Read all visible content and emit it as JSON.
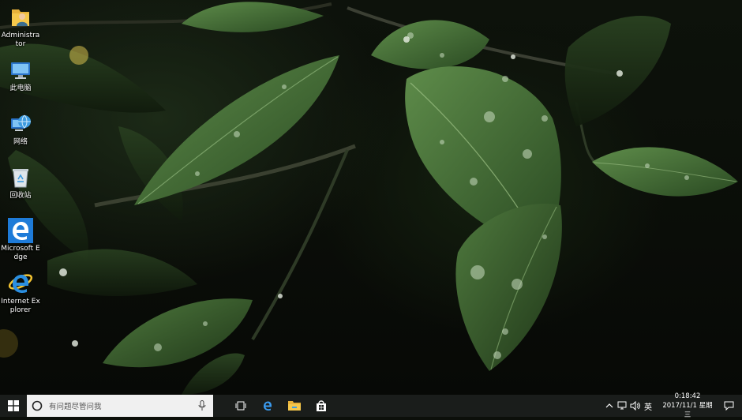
{
  "desktop": {
    "icons": [
      {
        "name": "user-folder",
        "label": "Administrator"
      },
      {
        "name": "this-pc",
        "label": "此电脑"
      },
      {
        "name": "network",
        "label": "网络"
      },
      {
        "name": "recycle-bin",
        "label": "回收站"
      },
      {
        "name": "microsoft-edge",
        "label": "Microsoft Edge"
      },
      {
        "name": "internet-explorer",
        "label": "Internet Explorer"
      }
    ]
  },
  "taskbar": {
    "search_placeholder": "有问题尽管问我",
    "pinned": [
      "task-view-icon",
      "edge-icon",
      "file-explorer-icon",
      "store-icon"
    ],
    "tray": {
      "ime": "英",
      "time": "0:18:42",
      "date": "2017/11/1 星期三"
    }
  },
  "colors": {
    "taskbar": "#1a1d1b",
    "search_box": "#f0f0f0",
    "edge_blue": "#1e7bd8",
    "leaf_green": "#3e6b32"
  }
}
